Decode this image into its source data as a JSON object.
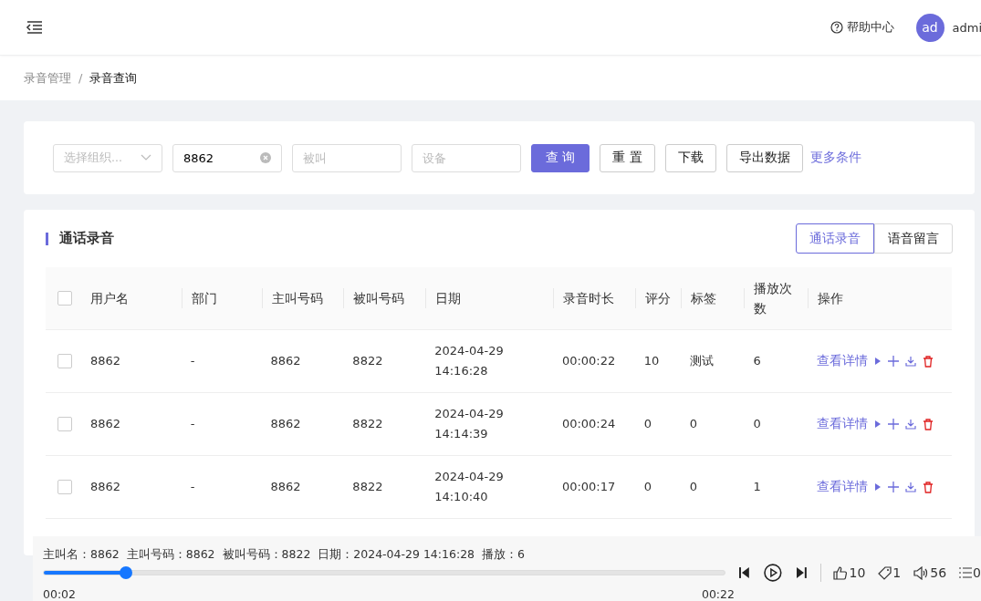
{
  "header": {
    "help": "帮助中心",
    "avatar": "ad",
    "user": "admi"
  },
  "breadcrumb": [
    {
      "label": "录音管理",
      "current": false
    },
    {
      "label": "录音查询",
      "current": true
    }
  ],
  "breadcrumb_separator": "/",
  "filters": {
    "org": {
      "placeholder": "选择组织..."
    },
    "caller": {
      "value": "8862"
    },
    "callee": {
      "placeholder": "被叫"
    },
    "device": {
      "placeholder": "设备"
    },
    "buttons": [
      {
        "label": "查 询",
        "kind": "primary"
      },
      {
        "label": "重 置",
        "kind": "default"
      },
      {
        "label": "下载",
        "kind": "default"
      },
      {
        "label": "导出数据",
        "kind": "default"
      },
      {
        "label": "更多条件",
        "kind": "link"
      }
    ]
  },
  "panel": {
    "title": "通话录音",
    "tabs": [
      {
        "label": "通话录音",
        "selected": true
      },
      {
        "label": "语音留言",
        "selected": false
      }
    ]
  },
  "table": {
    "all_checked": false,
    "columns": [
      "用户名",
      "部门",
      "主叫号码",
      "被叫号码",
      "日期",
      "录音时长",
      "评分",
      "标签",
      "播放次数",
      "操作"
    ],
    "rows": [
      {
        "checked": false,
        "cells": [
          "8862",
          "-",
          "8862",
          "8822",
          "2024-04-29\n14:16:28",
          "00:00:22",
          "10",
          "测试",
          "6"
        ],
        "action": "查看详情"
      },
      {
        "checked": false,
        "cells": [
          "8862",
          "-",
          "8862",
          "8822",
          "2024-04-29\n14:14:39",
          "00:00:24",
          "0",
          "0",
          "0"
        ],
        "action": "查看详情"
      },
      {
        "checked": false,
        "cells": [
          "8862",
          "-",
          "8862",
          "8822",
          "2024-04-29\n14:10:40",
          "00:00:17",
          "0",
          "0",
          "1"
        ],
        "action": "查看详情"
      }
    ]
  },
  "player": {
    "info": "主叫名：8862  主叫号码：8862  被叫号码：8822  日期：2024-04-29 14:16:28  播放：6",
    "level": 0.12,
    "current": "00:02",
    "total": "00:22",
    "likes": "10",
    "tags": "1",
    "volume": "56",
    "list": "0"
  }
}
